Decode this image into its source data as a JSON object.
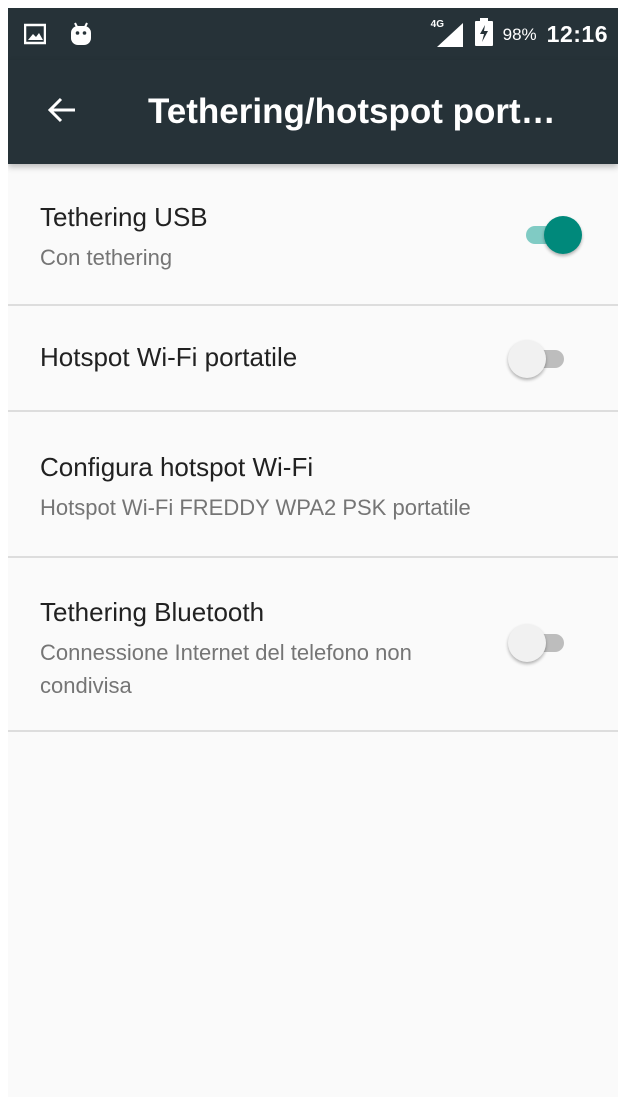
{
  "status_bar": {
    "left_icons": [
      "image-icon",
      "android-icon"
    ],
    "network_label": "4G",
    "battery_percent": "98%",
    "time": "12:16"
  },
  "toolbar": {
    "back_icon": "arrow-back-icon",
    "title": "Tethering/hotspot port…"
  },
  "settings": [
    {
      "title": "Tethering USB",
      "subtitle": "Con tethering",
      "has_switch": true,
      "switch_on": true
    },
    {
      "title": "Hotspot Wi-Fi portatile",
      "subtitle": "",
      "has_switch": true,
      "switch_on": false
    },
    {
      "title": "Configura hotspot Wi-Fi",
      "subtitle": "Hotspot Wi-Fi FREDDY WPA2 PSK portatile",
      "has_switch": false
    },
    {
      "title": "Tethering Bluetooth",
      "subtitle": "Connessione Internet del telefono non condivisa",
      "has_switch": true,
      "switch_on": false
    }
  ],
  "colors": {
    "toolbar_bg": "#263238",
    "accent": "#00897b",
    "accent_track": "#80cbc4",
    "list_bg": "#fafafa",
    "divider": "#dddddd"
  }
}
